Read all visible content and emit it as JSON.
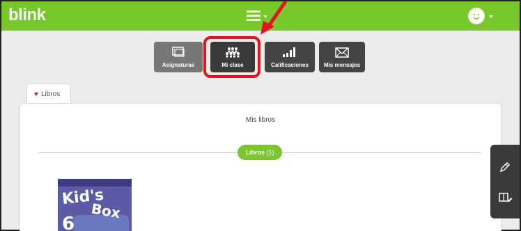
{
  "header": {
    "logo": "blink",
    "icons": {
      "menu": "hamburger-menu-icon",
      "avatar": "smiley-avatar-icon"
    },
    "colors": {
      "bar": "#79c82b"
    }
  },
  "nav": {
    "items": [
      {
        "label": "Asignaturas",
        "icon": "monitor-icon"
      },
      {
        "label": "Mi clase",
        "icon": "people-group-icon",
        "highlighted": true
      },
      {
        "label": "Calificaciones",
        "icon": "bar-chart-icon"
      },
      {
        "label": "Mis mensajes",
        "icon": "envelope-icon"
      }
    ],
    "highlight_color": "#e3141b"
  },
  "tab": {
    "label": "Libros"
  },
  "panel": {
    "title": "Mis libros",
    "pill_label": "Libros",
    "pill_count": "(1)",
    "book": {
      "title_line1": "Kid's",
      "title_line2": "Box",
      "number": "6"
    }
  },
  "side_tools": [
    {
      "icon": "pencil-icon"
    },
    {
      "icon": "book-edit-icon"
    }
  ]
}
